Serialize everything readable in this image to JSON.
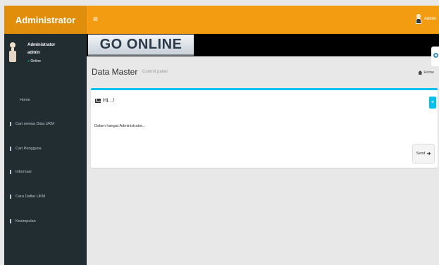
{
  "app": {
    "brand": "Administrator"
  },
  "topbar": {
    "menu_toggle": "≡",
    "user_label": "Admin"
  },
  "sidebar": {
    "user": {
      "name": "Administrator",
      "role": "admin",
      "status_dot": "●",
      "status": "Online"
    },
    "items": [
      {
        "label": "Home"
      },
      {
        "label": "Cari semua Data UKM"
      },
      {
        "label": "Cari Pengguna"
      },
      {
        "label": "Informasi"
      },
      {
        "label": "Cara Daftar UKM"
      },
      {
        "label": "Kesimpulan"
      }
    ]
  },
  "banner": {
    "text": "GO ONLINE"
  },
  "content_header": {
    "title": "Data Master",
    "subtitle": "Control panel",
    "breadcrumb": "Home"
  },
  "box": {
    "title": "Hi...!",
    "tool": "+",
    "body": "Dalam hangat Administrator...",
    "send_label": "Send",
    "send_icon": "➜"
  },
  "colors": {
    "topbar": "#f39c12",
    "logo": "#e08e0b",
    "sidebar": "#222d32",
    "accent": "#00c0ef"
  }
}
